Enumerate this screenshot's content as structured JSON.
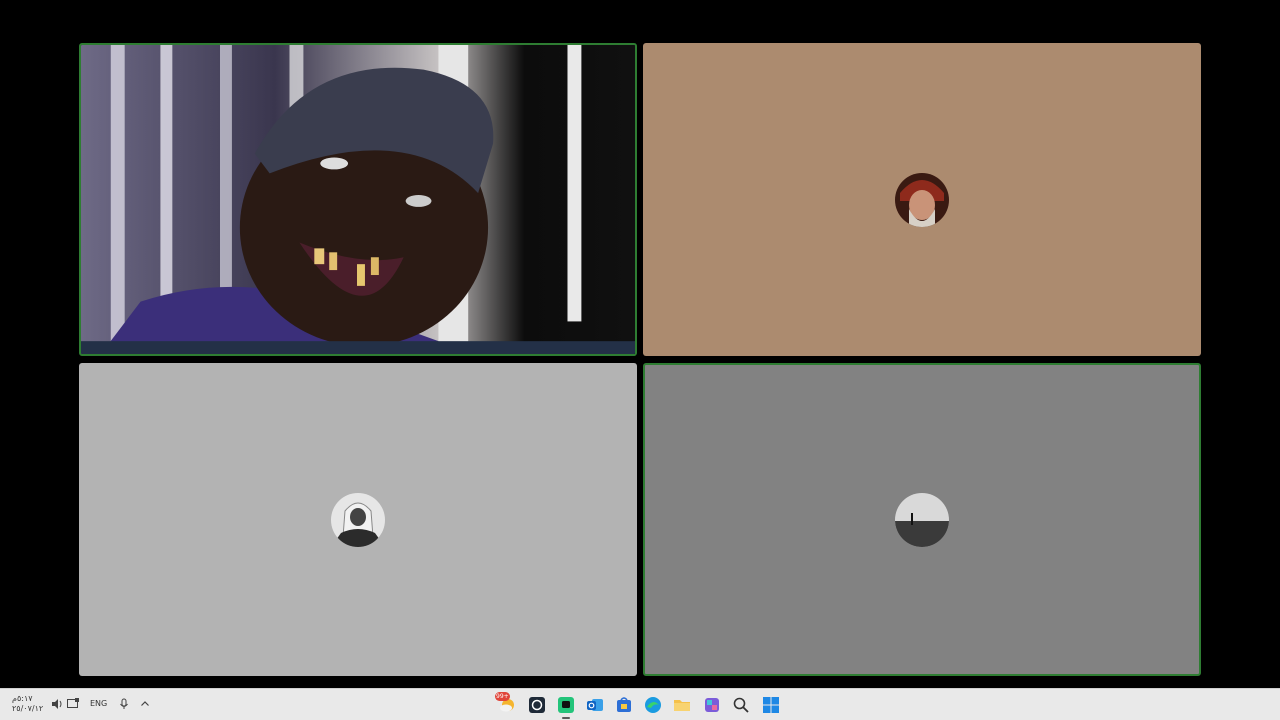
{
  "meeting": {
    "participants": [
      {
        "id": "p1",
        "state": "video-on",
        "active_speaker": true
      },
      {
        "id": "p2",
        "state": "avatar",
        "avatar_color": "#ac8b6f"
      },
      {
        "id": "p3",
        "state": "avatar",
        "avatar_color": "#b3b3b3"
      },
      {
        "id": "p4",
        "state": "avatar",
        "avatar_color": "#828282",
        "active_speaker": true
      }
    ],
    "active_border_color": "#2e7d32"
  },
  "taskbar": {
    "clock_time": "٥:١٧م",
    "clock_date": "٢٥/٠٧/١٢",
    "language": "ENG",
    "tray_icons": [
      "volume-icon",
      "screen-icon",
      "microphone-icon",
      "chevron-up-icon"
    ],
    "apps": [
      {
        "name": "weather-app-icon",
        "badge": "99+"
      },
      {
        "name": "screen-capture-app-icon"
      },
      {
        "name": "chat-app-icon",
        "active": true
      },
      {
        "name": "outlook-app-icon"
      },
      {
        "name": "store-app-icon"
      },
      {
        "name": "edge-app-icon"
      },
      {
        "name": "file-explorer-app-icon"
      },
      {
        "name": "copilot-app-icon"
      },
      {
        "name": "search-icon"
      },
      {
        "name": "start-icon"
      }
    ]
  }
}
